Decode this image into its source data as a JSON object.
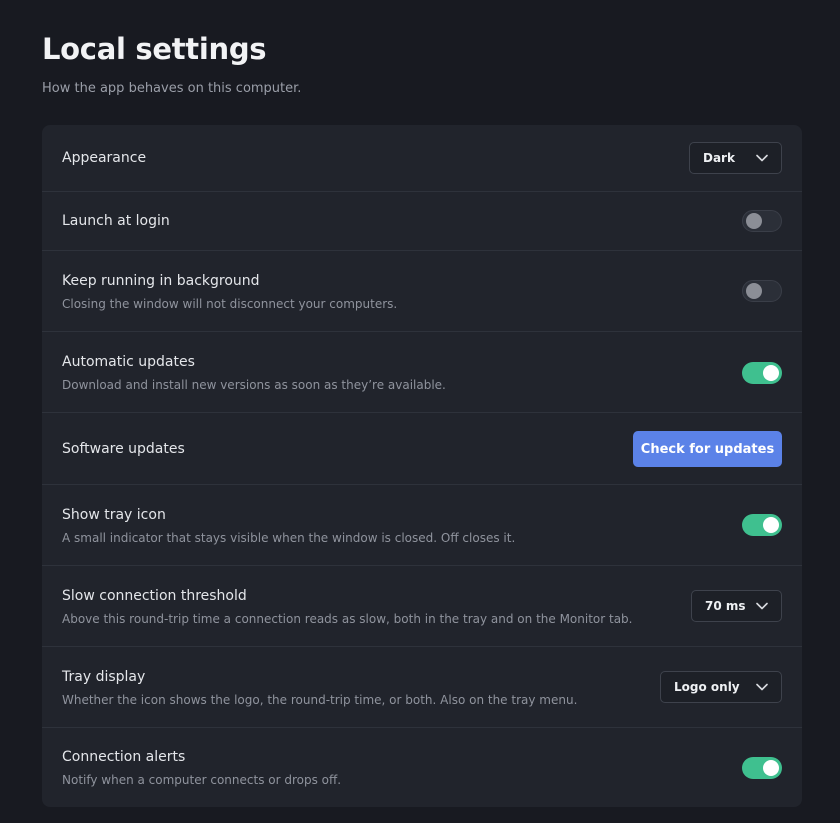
{
  "header": {
    "title": "Local settings",
    "subtitle": "How the app behaves on this computer."
  },
  "settings": [
    {
      "label": "Appearance",
      "description": "",
      "control": "select",
      "value": "Dark"
    },
    {
      "label": "Launch at login",
      "description": "",
      "control": "toggle",
      "on": false
    },
    {
      "label": "Keep running in background",
      "description": "Closing the window will not disconnect your computers.",
      "control": "toggle",
      "on": false
    },
    {
      "label": "Automatic updates",
      "description": "Download and install new versions as soon as they’re available.",
      "control": "toggle",
      "on": true
    },
    {
      "label": "Software updates",
      "description": "",
      "control": "button",
      "button_label": "Check for updates"
    },
    {
      "label": "Show tray icon",
      "description": "A small indicator that stays visible when the window is closed. Off closes it.",
      "control": "toggle",
      "on": true
    },
    {
      "label": "Slow connection threshold",
      "description": "Above this round-trip time a connection reads as slow, both in the tray and on the Monitor tab.",
      "control": "select",
      "value": "70 ms"
    },
    {
      "label": "Tray display",
      "description": "Whether the icon shows the logo, the round-trip time, or both. Also on the tray menu.",
      "control": "select",
      "value": "Logo only"
    },
    {
      "label": "Connection alerts",
      "description": "Notify when a computer connects or drops off.",
      "control": "toggle",
      "on": true
    }
  ],
  "colors": {
    "accent": "#5b82e8",
    "toggle_on": "#3fc08f",
    "background": "#181a21",
    "card": "#21242c"
  },
  "icons": {
    "select_caret": "chevron-down-icon"
  }
}
